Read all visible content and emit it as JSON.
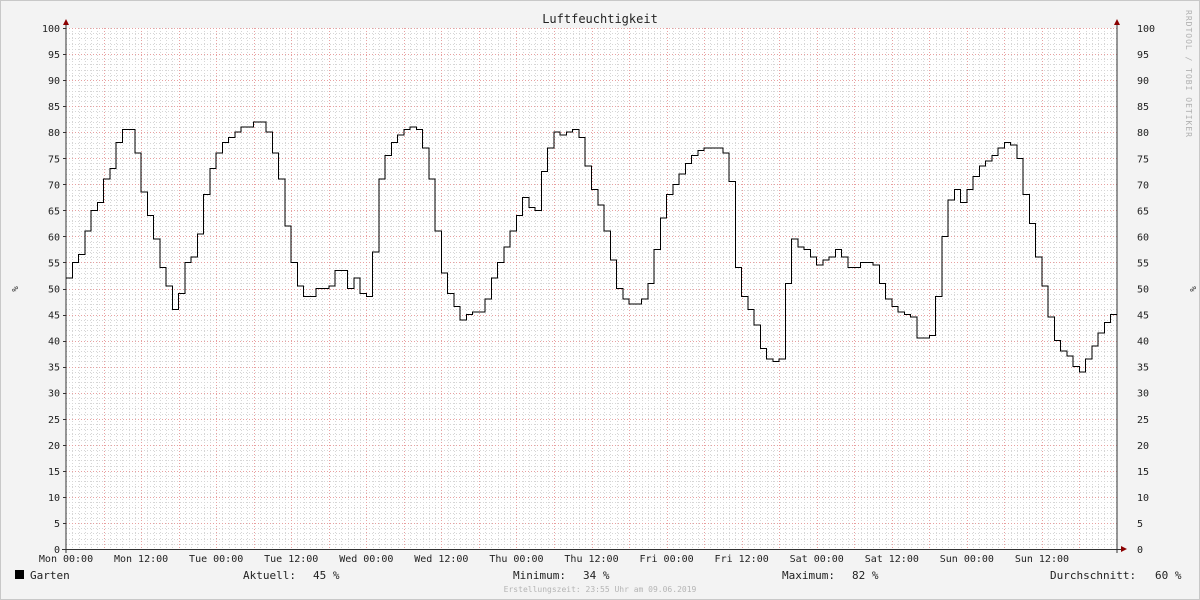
{
  "chart_data": {
    "type": "line",
    "title": "Luftfeuchtigkeit",
    "ylabel": "%",
    "ylabel_right": "%",
    "ylim": [
      0,
      100
    ],
    "yticks": [
      0,
      5,
      10,
      15,
      20,
      25,
      30,
      35,
      40,
      45,
      50,
      55,
      60,
      65,
      70,
      75,
      80,
      85,
      90,
      95,
      100
    ],
    "xlim": [
      0,
      168
    ],
    "xticks": [
      {
        "hour": 0,
        "label": "Mon 00:00"
      },
      {
        "hour": 12,
        "label": "Mon 12:00"
      },
      {
        "hour": 24,
        "label": "Tue 00:00"
      },
      {
        "hour": 36,
        "label": "Tue 12:00"
      },
      {
        "hour": 48,
        "label": "Wed 00:00"
      },
      {
        "hour": 60,
        "label": "Wed 12:00"
      },
      {
        "hour": 72,
        "label": "Thu 00:00"
      },
      {
        "hour": 84,
        "label": "Thu 12:00"
      },
      {
        "hour": 96,
        "label": "Fri 00:00"
      },
      {
        "hour": 108,
        "label": "Fri 12:00"
      },
      {
        "hour": 120,
        "label": "Sat 00:00"
      },
      {
        "hour": 132,
        "label": "Sat 12:00"
      },
      {
        "hour": 144,
        "label": "Sun 00:00"
      },
      {
        "hour": 156,
        "label": "Sun 12:00"
      }
    ],
    "series": [
      {
        "name": "Garten",
        "color": "#000000",
        "step": true,
        "x": [
          0,
          1,
          2,
          3,
          4,
          5,
          6,
          7,
          8,
          9,
          10,
          11,
          12,
          13,
          14,
          15,
          16,
          17,
          18,
          19,
          20,
          21,
          22,
          23,
          24,
          25,
          26,
          27,
          28,
          29,
          30,
          31,
          32,
          33,
          34,
          35,
          36,
          37,
          38,
          39,
          40,
          41,
          42,
          43,
          44,
          45,
          46,
          47,
          48,
          49,
          50,
          51,
          52,
          53,
          54,
          55,
          56,
          57,
          58,
          59,
          60,
          61,
          62,
          63,
          64,
          65,
          66,
          67,
          68,
          69,
          70,
          71,
          72,
          73,
          74,
          75,
          76,
          77,
          78,
          79,
          80,
          81,
          82,
          83,
          84,
          85,
          86,
          87,
          88,
          89,
          90,
          91,
          92,
          93,
          94,
          95,
          96,
          97,
          98,
          99,
          100,
          101,
          102,
          103,
          104,
          105,
          106,
          107,
          108,
          109,
          110,
          111,
          112,
          113,
          114,
          115,
          116,
          117,
          118,
          119,
          120,
          121,
          122,
          123,
          124,
          125,
          126,
          127,
          128,
          129,
          130,
          131,
          132,
          133,
          134,
          135,
          136,
          137,
          138,
          139,
          140,
          141,
          142,
          143,
          144,
          145,
          146,
          147,
          148,
          149,
          150,
          151,
          152,
          153,
          154,
          155,
          156,
          157,
          158,
          159,
          160,
          161,
          162,
          163,
          164,
          165,
          166,
          167,
          168
        ],
        "values": [
          52,
          55,
          56.5,
          61,
          65,
          66.5,
          71,
          73,
          78,
          80.5,
          80.5,
          76,
          68.5,
          64,
          59.5,
          54,
          50.5,
          46,
          49,
          55,
          56,
          60.5,
          68,
          73,
          76,
          78,
          79,
          80,
          81,
          81,
          82,
          82,
          80,
          76,
          71,
          62,
          55,
          50.5,
          48.5,
          48.5,
          50,
          50,
          50.5,
          53.5,
          53.5,
          50,
          52,
          49,
          48.5,
          57,
          71,
          75.5,
          78,
          79.5,
          80.5,
          81,
          80.5,
          77,
          71,
          61,
          53,
          49,
          46.5,
          44,
          45,
          45.5,
          45.5,
          48,
          52,
          55,
          58,
          61,
          64,
          67.5,
          65.5,
          65,
          72.5,
          77,
          80,
          79.5,
          80,
          80.5,
          79,
          73.5,
          69,
          66,
          61,
          55.5,
          50,
          48,
          47,
          47,
          48,
          51,
          57.5,
          63.5,
          68,
          70,
          72,
          74,
          75.5,
          76.5,
          77,
          77,
          77,
          76,
          70.5,
          54,
          48.5,
          46,
          43,
          38.5,
          36.5,
          36,
          36.5,
          51,
          59.5,
          58,
          57.5,
          56,
          54.5,
          55.5,
          56,
          57.5,
          56,
          54,
          54,
          55,
          55,
          54.5,
          51,
          48,
          46.5,
          45.5,
          45,
          44.5,
          40.5,
          40.5,
          41,
          48.5,
          60,
          67,
          69,
          66.5,
          69,
          71.5,
          73.5,
          74.5,
          75.5,
          77,
          78,
          77.5,
          75,
          68,
          62.5,
          56,
          50.5,
          44.5,
          40,
          38,
          37,
          35,
          34,
          36.5,
          39,
          41.5,
          43.5,
          45,
          45
        ]
      }
    ],
    "legend": {
      "label": "Garten",
      "color": "#000000",
      "position": "bottom-left"
    },
    "stats": {
      "current_label": "Aktuell:",
      "current_value": "45 %",
      "min_label": "Minimum:",
      "min_value": "34 %",
      "max_label": "Maximum:",
      "max_value": "82 %",
      "avg_label": "Durchschnitt:",
      "avg_value": "60 %"
    },
    "watermark": "RRDTOOL / TOBI OETIKER",
    "created": "Erstellungszeit: 23:55 Uhr am 09.06.2019",
    "colors": {
      "grid_major": "#e8a0a0",
      "grid_minor": "#d6d6d6",
      "background": "#ffffff",
      "canvas": "#f3f3f3",
      "axis": "#333333",
      "arrow": "#8b0000"
    }
  }
}
